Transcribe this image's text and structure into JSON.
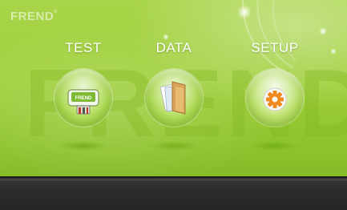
{
  "brand": {
    "logo_text": "FREND",
    "logo_mark": "®"
  },
  "menu": {
    "items": [
      {
        "label": "TEST",
        "icon": "test-device-icon"
      },
      {
        "label": "DATA",
        "icon": "folder-icon"
      },
      {
        "label": "SETUP",
        "icon": "gear-icon"
      }
    ]
  },
  "device_label": "FREND",
  "colors": {
    "background_green": "#9fcf3a",
    "bottom_bar": "#2e2e2e",
    "label_text": "#ffffff",
    "gear_orange": "#f08a1c"
  }
}
